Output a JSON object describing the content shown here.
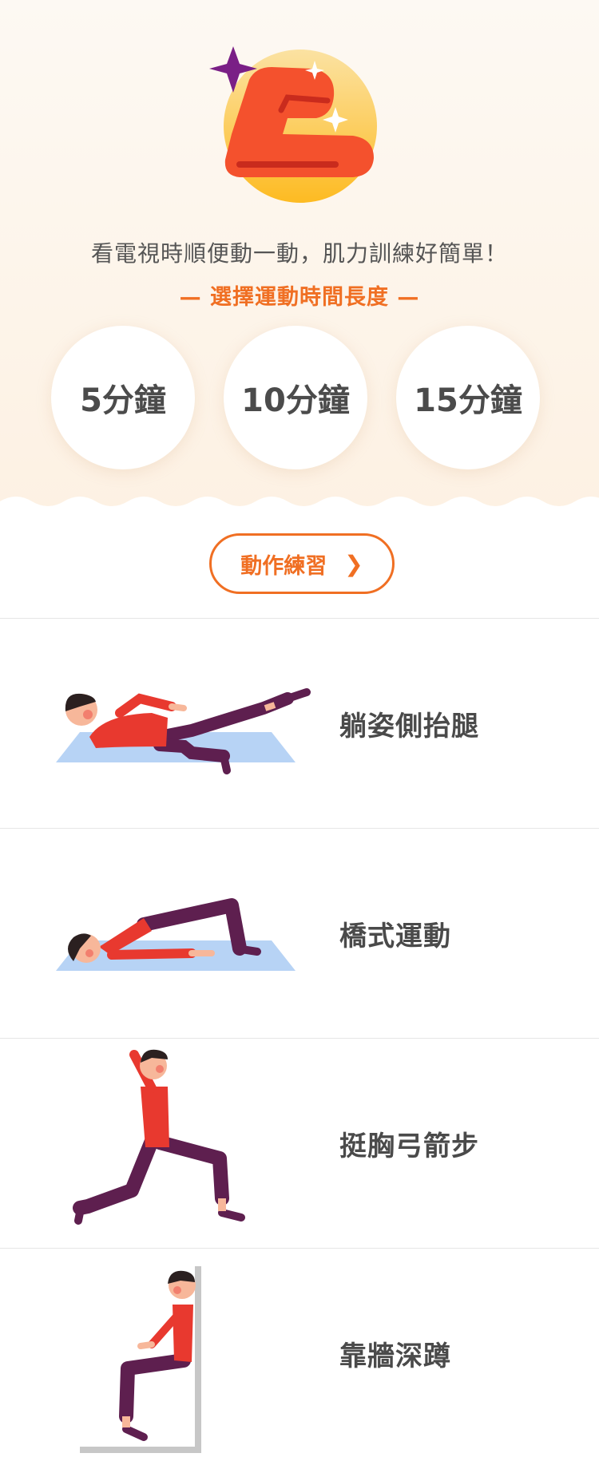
{
  "hero": {
    "tagline": "看電視時順便動一動，肌力訓練好簡單！",
    "subhead": "— 選擇運動時間長度 —",
    "durations": [
      "5分鐘",
      "10分鐘",
      "15分鐘"
    ],
    "icon": "lying-stretch-icon"
  },
  "practice_button": {
    "label": "動作練習",
    "icon": "chevron-right-icon"
  },
  "exercises": [
    {
      "label": "躺姿側抬腿",
      "icon": "side-leg-raise-illustration"
    },
    {
      "label": "橋式運動",
      "icon": "bridge-illustration"
    },
    {
      "label": "挺胸弓箭步",
      "icon": "lunge-illustration"
    },
    {
      "label": "靠牆深蹲",
      "icon": "wall-squat-illustration"
    }
  ],
  "colors": {
    "accent": "#f06f23",
    "hero_bg": "#fdf5ec",
    "figure_shirt": "#e8392f",
    "figure_pants": "#5e1f4f",
    "mat": "#b7d3f5",
    "skin": "#f7b79a",
    "sparkle_purple": "#7a1f86"
  }
}
